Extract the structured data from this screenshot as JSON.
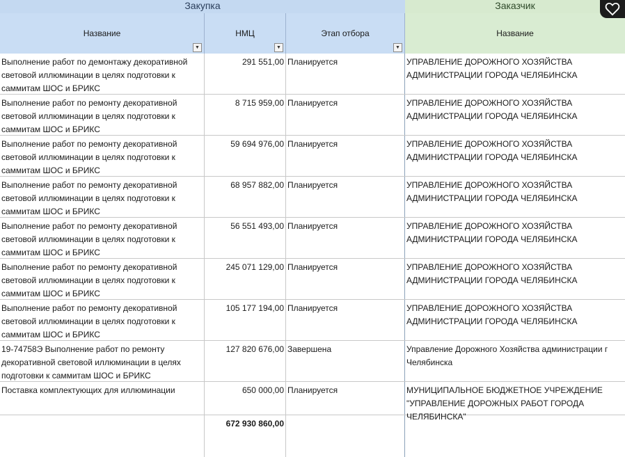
{
  "groups": {
    "purchase": "Закупка",
    "customer": "Заказчик"
  },
  "columns": {
    "name": "Название",
    "nmc": "НМЦ",
    "stage": "Этап отбора",
    "customer_name": "Название"
  },
  "rows": [
    {
      "name": "Выполнение работ по демонтажу декоративной световой иллюминации в целях подготовки к саммитам ШОС и БРИКС",
      "nmc": "291 551,00",
      "stage": "Планируется",
      "customer": "УПРАВЛЕНИЕ ДОРОЖНОГО ХОЗЯЙСТВА АДМИНИСТРАЦИИ ГОРОДА ЧЕЛЯБИНСКА"
    },
    {
      "name": "Выполнение работ по ремонту декоративной световой иллюминации в целях подготовки к саммитам ШОС и БРИКС",
      "nmc": "8 715 959,00",
      "stage": "Планируется",
      "customer": "УПРАВЛЕНИЕ ДОРОЖНОГО ХОЗЯЙСТВА АДМИНИСТРАЦИИ ГОРОДА ЧЕЛЯБИНСКА"
    },
    {
      "name": "Выполнение работ по ремонту декоративной световой иллюминации в целях подготовки к саммитам ШОС и БРИКС",
      "nmc": "59 694 976,00",
      "stage": "Планируется",
      "customer": "УПРАВЛЕНИЕ ДОРОЖНОГО ХОЗЯЙСТВА АДМИНИСТРАЦИИ ГОРОДА ЧЕЛЯБИНСКА"
    },
    {
      "name": "Выполнение работ по ремонту декоративной световой иллюминации в целях подготовки к саммитам ШОС и БРИКС",
      "nmc": "68 957 882,00",
      "stage": "Планируется",
      "customer": "УПРАВЛЕНИЕ ДОРОЖНОГО ХОЗЯЙСТВА АДМИНИСТРАЦИИ ГОРОДА ЧЕЛЯБИНСКА"
    },
    {
      "name": "Выполнение работ по ремонту декоративной световой иллюминации в целях подготовки к саммитам ШОС и БРИКС",
      "nmc": "56 551 493,00",
      "stage": "Планируется",
      "customer": "УПРАВЛЕНИЕ ДОРОЖНОГО ХОЗЯЙСТВА АДМИНИСТРАЦИИ ГОРОДА ЧЕЛЯБИНСКА"
    },
    {
      "name": "Выполнение работ по ремонту декоративной световой иллюминации в целях подготовки к саммитам ШОС и БРИКС",
      "nmc": "245 071 129,00",
      "stage": "Планируется",
      "customer": "УПРАВЛЕНИЕ ДОРОЖНОГО ХОЗЯЙСТВА АДМИНИСТРАЦИИ ГОРОДА ЧЕЛЯБИНСКА"
    },
    {
      "name": "Выполнение работ по ремонту декоративной световой иллюминации в целях подготовки к саммитам ШОС и БРИКС",
      "nmc": "105 177 194,00",
      "stage": "Планируется",
      "customer": "УПРАВЛЕНИЕ ДОРОЖНОГО ХОЗЯЙСТВА АДМИНИСТРАЦИИ ГОРОДА ЧЕЛЯБИНСКА"
    },
    {
      "name": "19-74758Э Выполнение работ по ремонту декоративной световой иллюминации в целях подготовки к саммитам ШОС и БРИКС",
      "nmc": "127 820 676,00",
      "stage": "Завершена",
      "customer_line1": "Управление Дорожного Хозяйства администрации г",
      "customer_line2": "Челябинска"
    },
    {
      "name": "Поставка комплектующих для иллюминации",
      "nmc": "650 000,00",
      "stage": "Планируется",
      "customer": "МУНИЦИПАЛЬНОЕ БЮДЖЕТНОЕ УЧРЕЖДЕНИЕ \"УПРАВЛЕНИЕ ДОРОЖНЫХ РАБОТ ГОРОДА ЧЕЛЯБИНСКА\""
    }
  ],
  "total": "672 930 860,00",
  "icons": {
    "filter": "dropdown-arrow-icon",
    "favorite": "heart-icon"
  }
}
